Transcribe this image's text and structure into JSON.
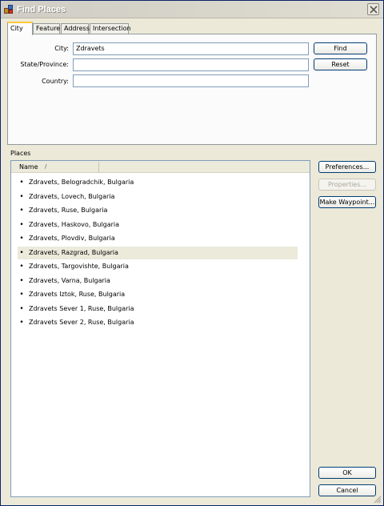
{
  "window": {
    "title": "Find Places",
    "app_icon": "globe-stack-icon",
    "close_icon": "close-icon"
  },
  "tabs": [
    {
      "label": "City",
      "active": true
    },
    {
      "label": "Feature",
      "active": false
    },
    {
      "label": "Address",
      "active": false
    },
    {
      "label": "Intersection",
      "active": false
    }
  ],
  "form": {
    "city_label": "City:",
    "city_value": "Zdravets",
    "state_label": "State/Province:",
    "state_value": "",
    "country_label": "Country:",
    "country_value": "",
    "find_label": "Find",
    "reset_label": "Reset"
  },
  "places": {
    "label": "Places",
    "column_name": "Name",
    "sort_glyph": "/",
    "selected_index": 5,
    "items": [
      "Zdravets, Belogradchik, Bulgaria",
      "Zdravets, Lovech, Bulgaria",
      "Zdravets, Ruse, Bulgaria",
      "Zdravets, Haskovo, Bulgaria",
      "Zdravets, Plovdiv, Bulgaria",
      "Zdravets, Razgrad, Bulgaria",
      "Zdravets, Targovishte, Bulgaria",
      "Zdravets, Varna, Bulgaria",
      "Zdravets Iztok, Ruse, Bulgaria",
      "Zdravets Sever 1, Ruse, Bulgaria",
      "Zdravets Sever 2, Ruse, Bulgaria"
    ]
  },
  "side_buttons": {
    "preferences_label": "Preferences...",
    "properties_label": "Properties...",
    "properties_enabled": false,
    "make_waypoint_label": "Make Waypoint..."
  },
  "footer": {
    "ok_label": "OK",
    "cancel_label": "Cancel"
  },
  "colors": {
    "selection": "#ebeadb",
    "tab_highlight": "#ffc83c",
    "dialog_bg": "#ece9d8"
  }
}
